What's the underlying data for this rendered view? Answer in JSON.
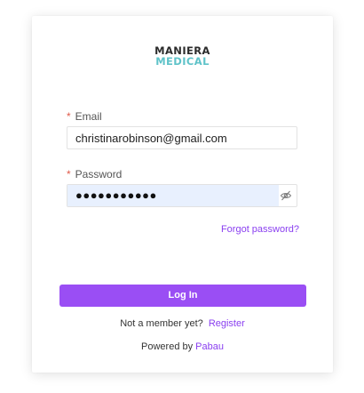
{
  "brand": {
    "line1": "MANIERA",
    "line2": "MEDICAL",
    "line1_color": "#2b2b2b",
    "line2_color": "#5fc3c9"
  },
  "form": {
    "required_marker": "*",
    "email": {
      "label": "Email",
      "value": "christinarobinson@gmail.com"
    },
    "password": {
      "label": "Password",
      "masked_value": "●●●●●●●●●●●",
      "toggle_icon": "eye-slash-icon"
    },
    "forgot_password_label": "Forgot password?",
    "login_button_label": "Log In"
  },
  "footer": {
    "member_prompt": "Not a member yet?",
    "register_label": "Register",
    "powered_prefix": "Powered by",
    "powered_brand": "Pabau"
  },
  "colors": {
    "accent": "#9a4ef4",
    "link": "#8a3ff0",
    "autofill_bg": "#e8f0fe",
    "required": "#e05a4a"
  }
}
